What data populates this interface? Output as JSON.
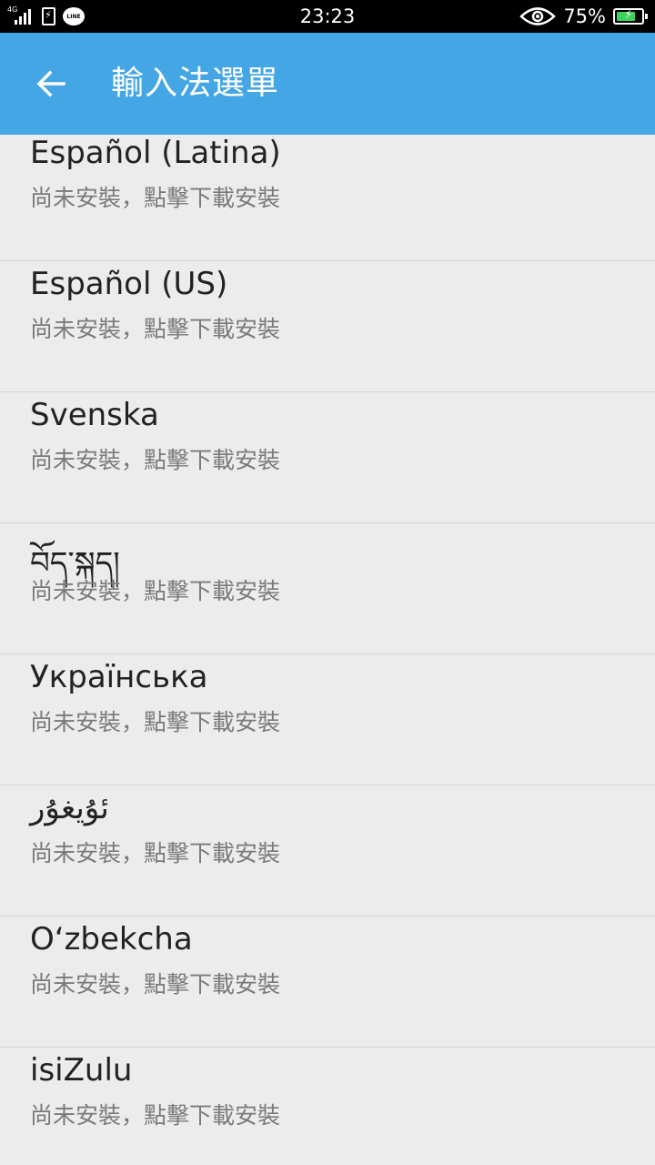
{
  "status_bar": {
    "network": "4G",
    "app_icon": "line-app-icon",
    "app_icon_text": "LINE",
    "time": "23:23",
    "eye_icon": "eye-icon",
    "battery_percent": "75%",
    "battery_level": 0.75,
    "battery_color": "#3cd35c"
  },
  "app_bar": {
    "title": "輸入法選單",
    "back_icon": "back-arrow-icon",
    "color": "#44a6e4"
  },
  "languages": [
    {
      "name": "Español (Latina)",
      "status": "尚未安裝，點擊下載安裝"
    },
    {
      "name": "Español (US)",
      "status": "尚未安裝，點擊下載安裝"
    },
    {
      "name": "Svenska",
      "status": "尚未安裝，點擊下載安裝"
    },
    {
      "name": "བོད་སྐད།",
      "status": "尚未安裝，點擊下載安裝"
    },
    {
      "name": "Українська",
      "status": "尚未安裝，點擊下載安裝"
    },
    {
      "name": "ئۇيغۇر",
      "status": "尚未安裝，點擊下載安裝"
    },
    {
      "name": "O‘zbekcha",
      "status": "尚未安裝，點擊下載安裝"
    },
    {
      "name": "isiZulu",
      "status": "尚未安裝，點擊下載安裝"
    }
  ]
}
